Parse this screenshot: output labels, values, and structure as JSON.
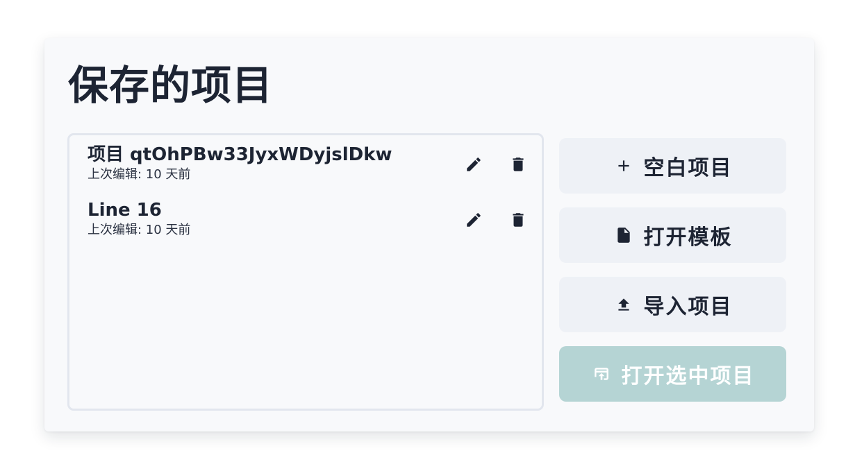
{
  "page": {
    "title": "保存的项目"
  },
  "projects": [
    {
      "name": "项目 qtOhPBw33JyxWDyjslDkw",
      "meta": "上次编辑: 10 天前"
    },
    {
      "name": "Line 16",
      "meta": "上次编辑: 10 天前"
    }
  ],
  "item_icons": {
    "edit": "pencil-icon",
    "delete": "trash-icon"
  },
  "actions": {
    "blank_project": {
      "label": "空白项目",
      "icon": "plus-icon"
    },
    "open_template": {
      "label": "打开模板",
      "icon": "file-icon"
    },
    "import_project": {
      "label": "导入项目",
      "icon": "upload-icon"
    },
    "open_selected": {
      "label": "打开选中项目",
      "icon": "open-in-icon",
      "disabled": true
    }
  },
  "colors": {
    "text": "#1d2433",
    "card_background": "#f8f9fb",
    "button_background": "#eef1f6",
    "disabled_button_background": "#b5d4d4",
    "panel_border": "#e2e6ee"
  }
}
